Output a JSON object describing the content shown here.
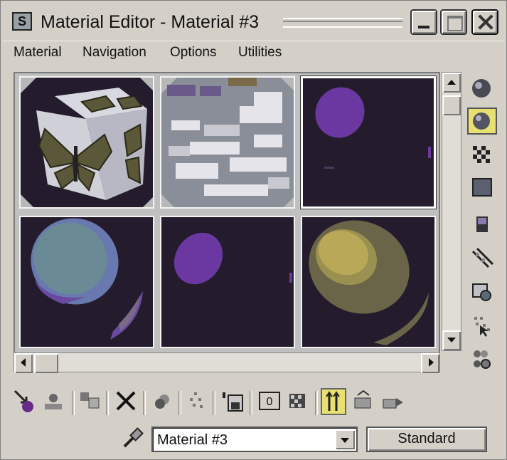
{
  "window": {
    "title": "Material Editor - Material #3",
    "app_icon": "3ds-max-icon",
    "controls": [
      "minimize-icon",
      "maximize-icon",
      "close-icon"
    ]
  },
  "menubar": {
    "items": [
      "Material",
      "Navigation",
      "Options",
      "Utilities"
    ]
  },
  "sample_slots": {
    "slot_types": [
      "butterfly-cube",
      "cloud-sphere",
      "purple-sphere",
      "blue-gray-sphere",
      "purple-sphere",
      "yellow-sphere"
    ],
    "active_slot": 2
  },
  "side_toolbar": {
    "items": [
      "sample-type-sphere-icon",
      "backlight-icon",
      "background-checker-icon",
      "sample-uv-tiling-icon",
      "video-color-check-icon",
      "make-preview-icon",
      "options-icon",
      "select-by-material-icon",
      "material-map-navigator-icon"
    ],
    "selected_index": 1
  },
  "bottom_toolbar": {
    "items": [
      "get-material-icon",
      "put-to-scene-icon",
      "assign-to-selection-icon",
      "reset-map-icon",
      "make-copy-icon",
      "make-unique-icon",
      "put-to-library-icon",
      "material-effects-channel-icon",
      "show-map-in-viewport-icon",
      "show-end-result-icon",
      "go-to-parent-icon",
      "go-forward-to-sibling-icon"
    ],
    "effects_channel_value": "0",
    "selected_index": 9
  },
  "material_row": {
    "selected_material": "Material #3",
    "type_button_label": "Standard",
    "picker_icon": "eyedropper-icon"
  },
  "colors": {
    "chrome": "#d4d0c8",
    "slot_background": "#241c2c",
    "highlight": "#e8e070"
  }
}
